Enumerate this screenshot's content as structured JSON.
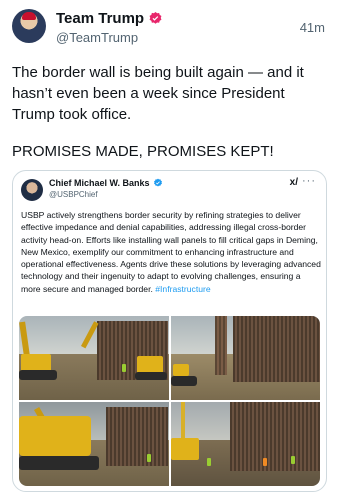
{
  "author": {
    "name": "Team Trump",
    "handle": "@TeamTrump",
    "time": "41m"
  },
  "tweet": {
    "paragraph1": "The border wall is being built again — and it hasn’t even been a week since President Trump took office.",
    "paragraph2": "PROMISES MADE, PROMISES KEPT!"
  },
  "quote": {
    "name": "Chief Michael W. Banks",
    "handle": "@USBPChief",
    "grok_label": "x/",
    "more_label": "···",
    "text": "USBP actively strengthens border security by refining strategies to deliver effective impedance and denial capabilities, addressing illegal cross-border activity head-on. Efforts like installing wall panels to fill critical gaps in Deming, New Mexico, exemplify our commitment to enhancing infrastructure and operational effectiveness. Agents drive these solutions by leveraging advanced technology and their ingenuity to adapt to evolving challenges, ensuring a more secure and managed border.",
    "hashtag": "#Infrastructure"
  },
  "colors": {
    "verified_badge": "#1d9bf0",
    "hashtag": "#1d9bf0",
    "text_secondary": "#536471"
  },
  "icons": {
    "verified": "verified-badge-icon",
    "grok": "grok-icon",
    "more": "more-options-icon"
  }
}
